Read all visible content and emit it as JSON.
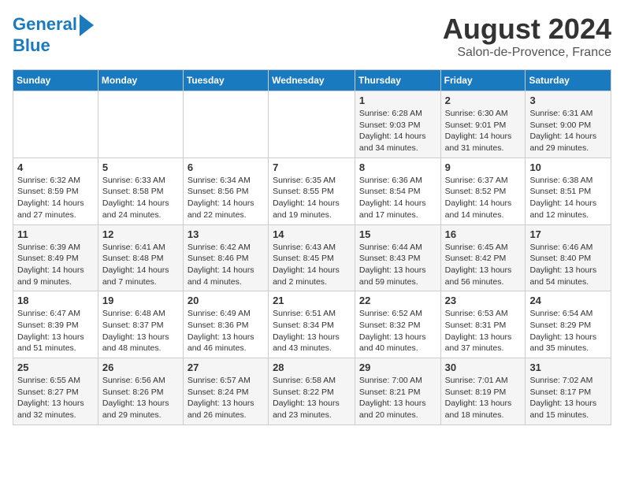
{
  "logo": {
    "line1": "General",
    "line2": "Blue"
  },
  "title": "August 2024",
  "subtitle": "Salon-de-Provence, France",
  "weekdays": [
    "Sunday",
    "Monday",
    "Tuesday",
    "Wednesday",
    "Thursday",
    "Friday",
    "Saturday"
  ],
  "weeks": [
    [
      {
        "day": "",
        "info": ""
      },
      {
        "day": "",
        "info": ""
      },
      {
        "day": "",
        "info": ""
      },
      {
        "day": "",
        "info": ""
      },
      {
        "day": "1",
        "info": "Sunrise: 6:28 AM\nSunset: 9:03 PM\nDaylight: 14 hours\nand 34 minutes."
      },
      {
        "day": "2",
        "info": "Sunrise: 6:30 AM\nSunset: 9:01 PM\nDaylight: 14 hours\nand 31 minutes."
      },
      {
        "day": "3",
        "info": "Sunrise: 6:31 AM\nSunset: 9:00 PM\nDaylight: 14 hours\nand 29 minutes."
      }
    ],
    [
      {
        "day": "4",
        "info": "Sunrise: 6:32 AM\nSunset: 8:59 PM\nDaylight: 14 hours\nand 27 minutes."
      },
      {
        "day": "5",
        "info": "Sunrise: 6:33 AM\nSunset: 8:58 PM\nDaylight: 14 hours\nand 24 minutes."
      },
      {
        "day": "6",
        "info": "Sunrise: 6:34 AM\nSunset: 8:56 PM\nDaylight: 14 hours\nand 22 minutes."
      },
      {
        "day": "7",
        "info": "Sunrise: 6:35 AM\nSunset: 8:55 PM\nDaylight: 14 hours\nand 19 minutes."
      },
      {
        "day": "8",
        "info": "Sunrise: 6:36 AM\nSunset: 8:54 PM\nDaylight: 14 hours\nand 17 minutes."
      },
      {
        "day": "9",
        "info": "Sunrise: 6:37 AM\nSunset: 8:52 PM\nDaylight: 14 hours\nand 14 minutes."
      },
      {
        "day": "10",
        "info": "Sunrise: 6:38 AM\nSunset: 8:51 PM\nDaylight: 14 hours\nand 12 minutes."
      }
    ],
    [
      {
        "day": "11",
        "info": "Sunrise: 6:39 AM\nSunset: 8:49 PM\nDaylight: 14 hours\nand 9 minutes."
      },
      {
        "day": "12",
        "info": "Sunrise: 6:41 AM\nSunset: 8:48 PM\nDaylight: 14 hours\nand 7 minutes."
      },
      {
        "day": "13",
        "info": "Sunrise: 6:42 AM\nSunset: 8:46 PM\nDaylight: 14 hours\nand 4 minutes."
      },
      {
        "day": "14",
        "info": "Sunrise: 6:43 AM\nSunset: 8:45 PM\nDaylight: 14 hours\nand 2 minutes."
      },
      {
        "day": "15",
        "info": "Sunrise: 6:44 AM\nSunset: 8:43 PM\nDaylight: 13 hours\nand 59 minutes."
      },
      {
        "day": "16",
        "info": "Sunrise: 6:45 AM\nSunset: 8:42 PM\nDaylight: 13 hours\nand 56 minutes."
      },
      {
        "day": "17",
        "info": "Sunrise: 6:46 AM\nSunset: 8:40 PM\nDaylight: 13 hours\nand 54 minutes."
      }
    ],
    [
      {
        "day": "18",
        "info": "Sunrise: 6:47 AM\nSunset: 8:39 PM\nDaylight: 13 hours\nand 51 minutes."
      },
      {
        "day": "19",
        "info": "Sunrise: 6:48 AM\nSunset: 8:37 PM\nDaylight: 13 hours\nand 48 minutes."
      },
      {
        "day": "20",
        "info": "Sunrise: 6:49 AM\nSunset: 8:36 PM\nDaylight: 13 hours\nand 46 minutes."
      },
      {
        "day": "21",
        "info": "Sunrise: 6:51 AM\nSunset: 8:34 PM\nDaylight: 13 hours\nand 43 minutes."
      },
      {
        "day": "22",
        "info": "Sunrise: 6:52 AM\nSunset: 8:32 PM\nDaylight: 13 hours\nand 40 minutes."
      },
      {
        "day": "23",
        "info": "Sunrise: 6:53 AM\nSunset: 8:31 PM\nDaylight: 13 hours\nand 37 minutes."
      },
      {
        "day": "24",
        "info": "Sunrise: 6:54 AM\nSunset: 8:29 PM\nDaylight: 13 hours\nand 35 minutes."
      }
    ],
    [
      {
        "day": "25",
        "info": "Sunrise: 6:55 AM\nSunset: 8:27 PM\nDaylight: 13 hours\nand 32 minutes."
      },
      {
        "day": "26",
        "info": "Sunrise: 6:56 AM\nSunset: 8:26 PM\nDaylight: 13 hours\nand 29 minutes."
      },
      {
        "day": "27",
        "info": "Sunrise: 6:57 AM\nSunset: 8:24 PM\nDaylight: 13 hours\nand 26 minutes."
      },
      {
        "day": "28",
        "info": "Sunrise: 6:58 AM\nSunset: 8:22 PM\nDaylight: 13 hours\nand 23 minutes."
      },
      {
        "day": "29",
        "info": "Sunrise: 7:00 AM\nSunset: 8:21 PM\nDaylight: 13 hours\nand 20 minutes."
      },
      {
        "day": "30",
        "info": "Sunrise: 7:01 AM\nSunset: 8:19 PM\nDaylight: 13 hours\nand 18 minutes."
      },
      {
        "day": "31",
        "info": "Sunrise: 7:02 AM\nSunset: 8:17 PM\nDaylight: 13 hours\nand 15 minutes."
      }
    ]
  ]
}
